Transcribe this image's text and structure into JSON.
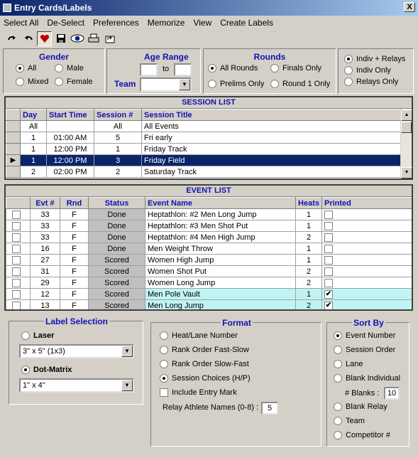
{
  "window": {
    "title": "Entry Cards/Labels",
    "close": "X"
  },
  "menu": [
    "Select All",
    "De-Select",
    "Preferences",
    "Memorize",
    "View",
    "Create Labels"
  ],
  "toolbar_icons": [
    "redo-icon",
    "undo-icon",
    "heart-icon",
    "save-icon",
    "eye-icon",
    "print-icon",
    "export-icon"
  ],
  "filters": {
    "gender": {
      "title": "Gender",
      "options": [
        "All",
        "Male",
        "Mixed",
        "Female"
      ],
      "selected": "All"
    },
    "age": {
      "title": "Age Range",
      "from": "",
      "to_label": "to",
      "to": "",
      "team_label": "Team",
      "team": ""
    },
    "rounds": {
      "title": "Rounds",
      "options": [
        "All Rounds",
        "Finals Only",
        "Prelims Only",
        "Round 1 Only"
      ],
      "selected": "All Rounds"
    },
    "type": {
      "options": [
        "Indiv + Relays",
        "Indiv Only",
        "Relays Only"
      ],
      "selected": "Indiv + Relays"
    }
  },
  "session_list": {
    "title": "SESSION LIST",
    "columns": [
      "Day",
      "Start Time",
      "Session #",
      "Session Title"
    ],
    "rows": [
      [
        "All",
        "",
        "All",
        "All Events"
      ],
      [
        "1",
        "01:00 AM",
        "5",
        "Fri early"
      ],
      [
        "1",
        "12:00 PM",
        "1",
        "Friday Track"
      ],
      [
        "1",
        "12:00 PM",
        "3",
        "Friday Field"
      ],
      [
        "2",
        "02:00 PM",
        "2",
        "Saturday Track"
      ]
    ],
    "selected_index": 3
  },
  "event_list": {
    "title": "EVENT LIST",
    "columns": [
      "Evt #",
      "Rnd",
      "Status",
      "Event Name",
      "Heats",
      "Printed"
    ],
    "rows": [
      {
        "evt": "33",
        "rnd": "F",
        "status": "Done",
        "name": "Heptathlon: #2 Men Long Jump",
        "heats": "1",
        "printed": false
      },
      {
        "evt": "33",
        "rnd": "F",
        "status": "Done",
        "name": "Heptathlon: #3 Men Shot Put",
        "heats": "1",
        "printed": false
      },
      {
        "evt": "33",
        "rnd": "F",
        "status": "Done",
        "name": "Heptathlon: #4 Men High Jump",
        "heats": "2",
        "printed": false
      },
      {
        "evt": "16",
        "rnd": "F",
        "status": "Done",
        "name": "Men Weight Throw",
        "heats": "1",
        "printed": false
      },
      {
        "evt": "27",
        "rnd": "F",
        "status": "Scored",
        "name": "Women High Jump",
        "heats": "1",
        "printed": false
      },
      {
        "evt": "31",
        "rnd": "F",
        "status": "Scored",
        "name": "Women Shot Put",
        "heats": "2",
        "printed": false
      },
      {
        "evt": "29",
        "rnd": "F",
        "status": "Scored",
        "name": "Women Long Jump",
        "heats": "2",
        "printed": false
      },
      {
        "evt": "12",
        "rnd": "F",
        "status": "Scored",
        "name": "Men Pole Vault",
        "heats": "1",
        "printed": true
      },
      {
        "evt": "13",
        "rnd": "F",
        "status": "Scored",
        "name": "Men Long Jump",
        "heats": "2",
        "printed": true
      }
    ]
  },
  "label_selection": {
    "title": "Label Selection",
    "laser": "Laser",
    "laser_size": "3\" x 5\" (1x3)",
    "dot": "Dot-Matrix",
    "dot_size": "1\" x 4\"",
    "selected": "Dot-Matrix"
  },
  "format": {
    "title": "Format",
    "options": [
      "Heat/Lane Number",
      "Rank Order Fast-Slow",
      "Rank Order Slow-Fast",
      "Session Choices (H/P)"
    ],
    "selected": "Session Choices (H/P)",
    "include_entry_mark": "Include Entry Mark",
    "relay_label": "Relay Athlete Names (0-8) :",
    "relay_value": "5"
  },
  "sort_by": {
    "title": "Sort By",
    "options": [
      "Event Number",
      "Session Order",
      "Lane",
      "Blank Individual",
      "Blank Relay",
      "Team",
      "Competitor #"
    ],
    "selected": "Event Number",
    "blanks_label": "# Blanks :",
    "blanks_value": "10"
  }
}
